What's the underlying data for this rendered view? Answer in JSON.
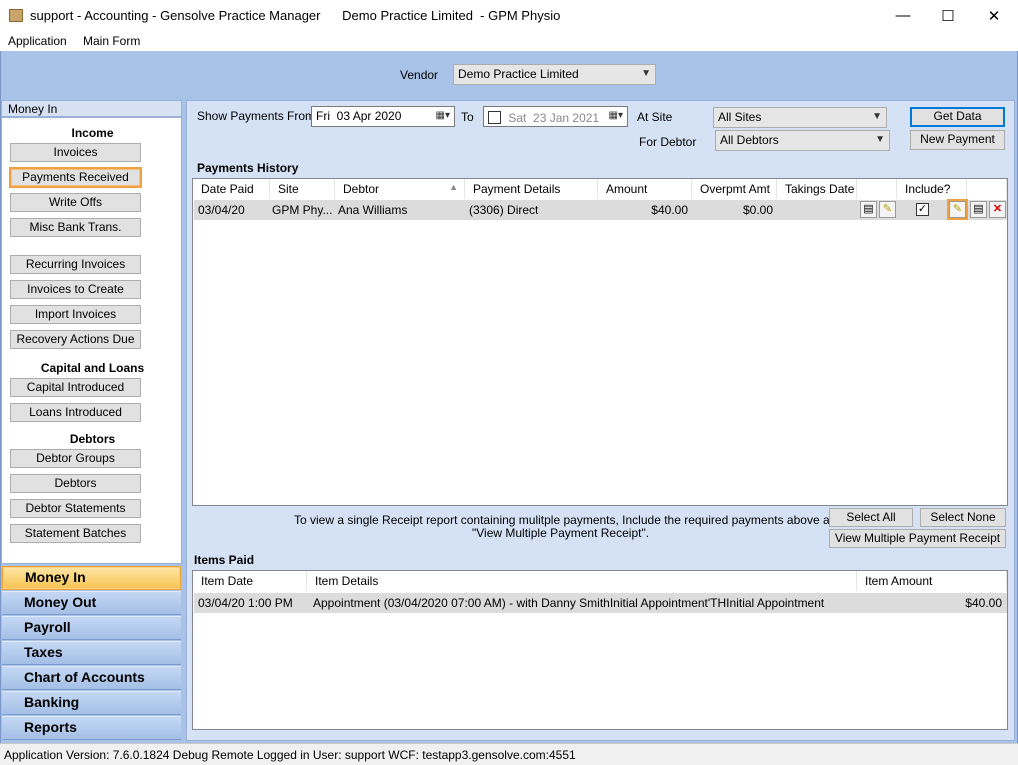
{
  "window": {
    "title": "support - Accounting - Gensolve Practice Manager      Demo Practice Limited  - GPM Physio",
    "minimize": "—",
    "maximize": "☐",
    "close": "✕"
  },
  "menu": {
    "items": [
      "Application",
      "Main Form"
    ]
  },
  "vendor": {
    "label": "Vendor",
    "value": "Demo Practice Limited"
  },
  "sidebar": {
    "header": "Money In",
    "sections": {
      "income": "Income",
      "capital": "Capital and Loans",
      "debtors": "Debtors"
    },
    "buttons": {
      "invoices": "Invoices",
      "payments_received": "Payments Received",
      "write_offs": "Write Offs",
      "misc_bank": "Misc Bank Trans.",
      "recurring": "Recurring Invoices",
      "to_create": "Invoices to Create",
      "import": "Import Invoices",
      "recovery": "Recovery Actions Due",
      "capital_introduced": "Capital Introduced",
      "loans_introduced": "Loans Introduced",
      "debtor_groups": "Debtor Groups",
      "debtors": "Debtors",
      "debtor_statements": "Debtor Statements",
      "statement_batches": "Statement Batches"
    },
    "nav": [
      "Money In",
      "Money Out",
      "Payroll",
      "Taxes",
      "Chart of Accounts",
      "Banking",
      "Reports"
    ]
  },
  "filters": {
    "show_from_label": "Show Payments From",
    "from_day": "Fri",
    "from_date": "03  Apr  2020",
    "to_label": "To",
    "to_day": "Sat",
    "to_date": "23  Jan  2021",
    "site_label": "At Site",
    "site_value": "All Sites",
    "debtor_label": "For Debtor",
    "debtor_value": "All Debtors",
    "get_data": "Get Data",
    "new_payment": "New Payment"
  },
  "payments": {
    "title": "Payments History",
    "columns": [
      "Date Paid",
      "Site",
      "Debtor",
      "Payment Details",
      "Amount",
      "Overpmt Amt",
      "Takings Date",
      "Include?"
    ],
    "rows": [
      {
        "date": "03/04/20",
        "site": "GPM Phy...",
        "debtor": "Ana Williams",
        "details": "(3306) Direct",
        "amount": "$40.00",
        "overpmt": "$0.00",
        "takings": ""
      }
    ],
    "info": "To view a single Receipt report containing mulitple payments, Include the required payments above and press",
    "info2": "\"View Multiple Payment Receipt\".",
    "select_all": "Select All",
    "select_none": "Select None",
    "view_multi": "View Multiple Payment Receipt"
  },
  "items": {
    "title": "Items Paid",
    "columns": [
      "Item Date",
      "Item Details",
      "Item Amount"
    ],
    "rows": [
      {
        "date": "03/04/20 1:00 PM",
        "details": "Appointment (03/04/2020 07:00 AM) -  with Danny SmithInitial Appointment'THInitial Appointment",
        "amount": "$40.00"
      }
    ]
  },
  "status": "Application Version: 7.6.0.1824 Debug Remote   Logged in User: support  WCF: testapp3.gensolve.com:4551",
  "colors": {
    "client": "#a8c2e8",
    "panel": "#d5e2f5",
    "highlight": "#f0a040"
  }
}
